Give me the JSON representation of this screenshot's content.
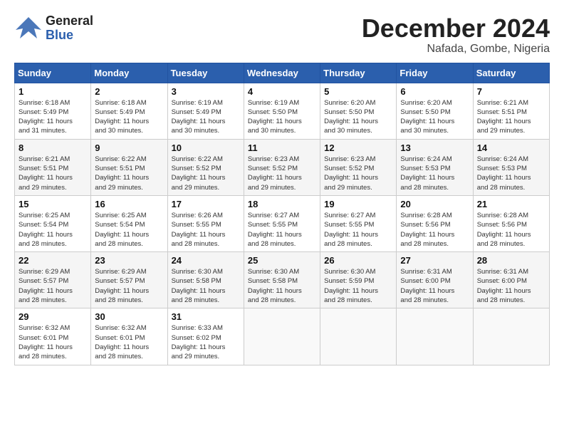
{
  "header": {
    "logo_general": "General",
    "logo_blue": "Blue",
    "month_title": "December 2024",
    "location": "Nafada, Gombe, Nigeria"
  },
  "calendar": {
    "days_of_week": [
      "Sunday",
      "Monday",
      "Tuesday",
      "Wednesday",
      "Thursday",
      "Friday",
      "Saturday"
    ],
    "weeks": [
      [
        {
          "day": "",
          "info": ""
        },
        {
          "day": "2",
          "info": "Sunrise: 6:18 AM\nSunset: 5:49 PM\nDaylight: 11 hours\nand 30 minutes."
        },
        {
          "day": "3",
          "info": "Sunrise: 6:19 AM\nSunset: 5:49 PM\nDaylight: 11 hours\nand 30 minutes."
        },
        {
          "day": "4",
          "info": "Sunrise: 6:19 AM\nSunset: 5:50 PM\nDaylight: 11 hours\nand 30 minutes."
        },
        {
          "day": "5",
          "info": "Sunrise: 6:20 AM\nSunset: 5:50 PM\nDaylight: 11 hours\nand 30 minutes."
        },
        {
          "day": "6",
          "info": "Sunrise: 6:20 AM\nSunset: 5:50 PM\nDaylight: 11 hours\nand 30 minutes."
        },
        {
          "day": "7",
          "info": "Sunrise: 6:21 AM\nSunset: 5:51 PM\nDaylight: 11 hours\nand 29 minutes."
        }
      ],
      [
        {
          "day": "8",
          "info": "Sunrise: 6:21 AM\nSunset: 5:51 PM\nDaylight: 11 hours\nand 29 minutes."
        },
        {
          "day": "9",
          "info": "Sunrise: 6:22 AM\nSunset: 5:51 PM\nDaylight: 11 hours\nand 29 minutes."
        },
        {
          "day": "10",
          "info": "Sunrise: 6:22 AM\nSunset: 5:52 PM\nDaylight: 11 hours\nand 29 minutes."
        },
        {
          "day": "11",
          "info": "Sunrise: 6:23 AM\nSunset: 5:52 PM\nDaylight: 11 hours\nand 29 minutes."
        },
        {
          "day": "12",
          "info": "Sunrise: 6:23 AM\nSunset: 5:52 PM\nDaylight: 11 hours\nand 29 minutes."
        },
        {
          "day": "13",
          "info": "Sunrise: 6:24 AM\nSunset: 5:53 PM\nDaylight: 11 hours\nand 28 minutes."
        },
        {
          "day": "14",
          "info": "Sunrise: 6:24 AM\nSunset: 5:53 PM\nDaylight: 11 hours\nand 28 minutes."
        }
      ],
      [
        {
          "day": "15",
          "info": "Sunrise: 6:25 AM\nSunset: 5:54 PM\nDaylight: 11 hours\nand 28 minutes."
        },
        {
          "day": "16",
          "info": "Sunrise: 6:25 AM\nSunset: 5:54 PM\nDaylight: 11 hours\nand 28 minutes."
        },
        {
          "day": "17",
          "info": "Sunrise: 6:26 AM\nSunset: 5:55 PM\nDaylight: 11 hours\nand 28 minutes."
        },
        {
          "day": "18",
          "info": "Sunrise: 6:27 AM\nSunset: 5:55 PM\nDaylight: 11 hours\nand 28 minutes."
        },
        {
          "day": "19",
          "info": "Sunrise: 6:27 AM\nSunset: 5:55 PM\nDaylight: 11 hours\nand 28 minutes."
        },
        {
          "day": "20",
          "info": "Sunrise: 6:28 AM\nSunset: 5:56 PM\nDaylight: 11 hours\nand 28 minutes."
        },
        {
          "day": "21",
          "info": "Sunrise: 6:28 AM\nSunset: 5:56 PM\nDaylight: 11 hours\nand 28 minutes."
        }
      ],
      [
        {
          "day": "22",
          "info": "Sunrise: 6:29 AM\nSunset: 5:57 PM\nDaylight: 11 hours\nand 28 minutes."
        },
        {
          "day": "23",
          "info": "Sunrise: 6:29 AM\nSunset: 5:57 PM\nDaylight: 11 hours\nand 28 minutes."
        },
        {
          "day": "24",
          "info": "Sunrise: 6:30 AM\nSunset: 5:58 PM\nDaylight: 11 hours\nand 28 minutes."
        },
        {
          "day": "25",
          "info": "Sunrise: 6:30 AM\nSunset: 5:58 PM\nDaylight: 11 hours\nand 28 minutes."
        },
        {
          "day": "26",
          "info": "Sunrise: 6:30 AM\nSunset: 5:59 PM\nDaylight: 11 hours\nand 28 minutes."
        },
        {
          "day": "27",
          "info": "Sunrise: 6:31 AM\nSunset: 6:00 PM\nDaylight: 11 hours\nand 28 minutes."
        },
        {
          "day": "28",
          "info": "Sunrise: 6:31 AM\nSunset: 6:00 PM\nDaylight: 11 hours\nand 28 minutes."
        }
      ],
      [
        {
          "day": "29",
          "info": "Sunrise: 6:32 AM\nSunset: 6:01 PM\nDaylight: 11 hours\nand 28 minutes."
        },
        {
          "day": "30",
          "info": "Sunrise: 6:32 AM\nSunset: 6:01 PM\nDaylight: 11 hours\nand 28 minutes."
        },
        {
          "day": "31",
          "info": "Sunrise: 6:33 AM\nSunset: 6:02 PM\nDaylight: 11 hours\nand 29 minutes."
        },
        {
          "day": "",
          "info": ""
        },
        {
          "day": "",
          "info": ""
        },
        {
          "day": "",
          "info": ""
        },
        {
          "day": "",
          "info": ""
        }
      ]
    ],
    "week1_day1": {
      "day": "1",
      "info": "Sunrise: 6:18 AM\nSunset: 5:49 PM\nDaylight: 11 hours\nand 31 minutes."
    }
  }
}
